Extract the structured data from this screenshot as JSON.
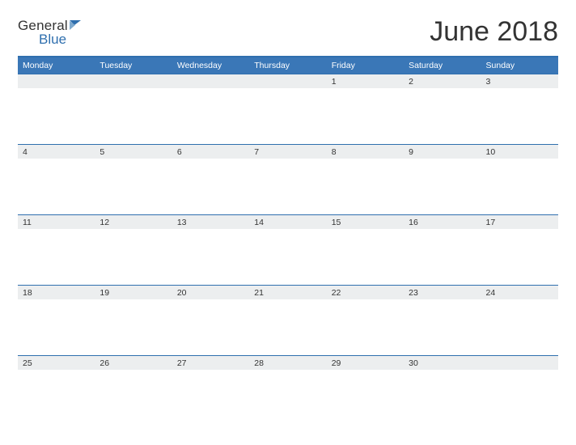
{
  "logo": {
    "line1": "General",
    "line2": "Blue"
  },
  "title": "June 2018",
  "headers": [
    "Monday",
    "Tuesday",
    "Wednesday",
    "Thursday",
    "Friday",
    "Saturday",
    "Sunday"
  ],
  "weeks": [
    [
      "",
      "",
      "",
      "",
      "1",
      "2",
      "3"
    ],
    [
      "4",
      "5",
      "6",
      "7",
      "8",
      "9",
      "10"
    ],
    [
      "11",
      "12",
      "13",
      "14",
      "15",
      "16",
      "17"
    ],
    [
      "18",
      "19",
      "20",
      "21",
      "22",
      "23",
      "24"
    ],
    [
      "25",
      "26",
      "27",
      "28",
      "29",
      "30",
      ""
    ]
  ],
  "colors": {
    "brandBlue": "#2f6fae",
    "headerBg": "#3a77b7",
    "bandBg": "#eceeef"
  }
}
